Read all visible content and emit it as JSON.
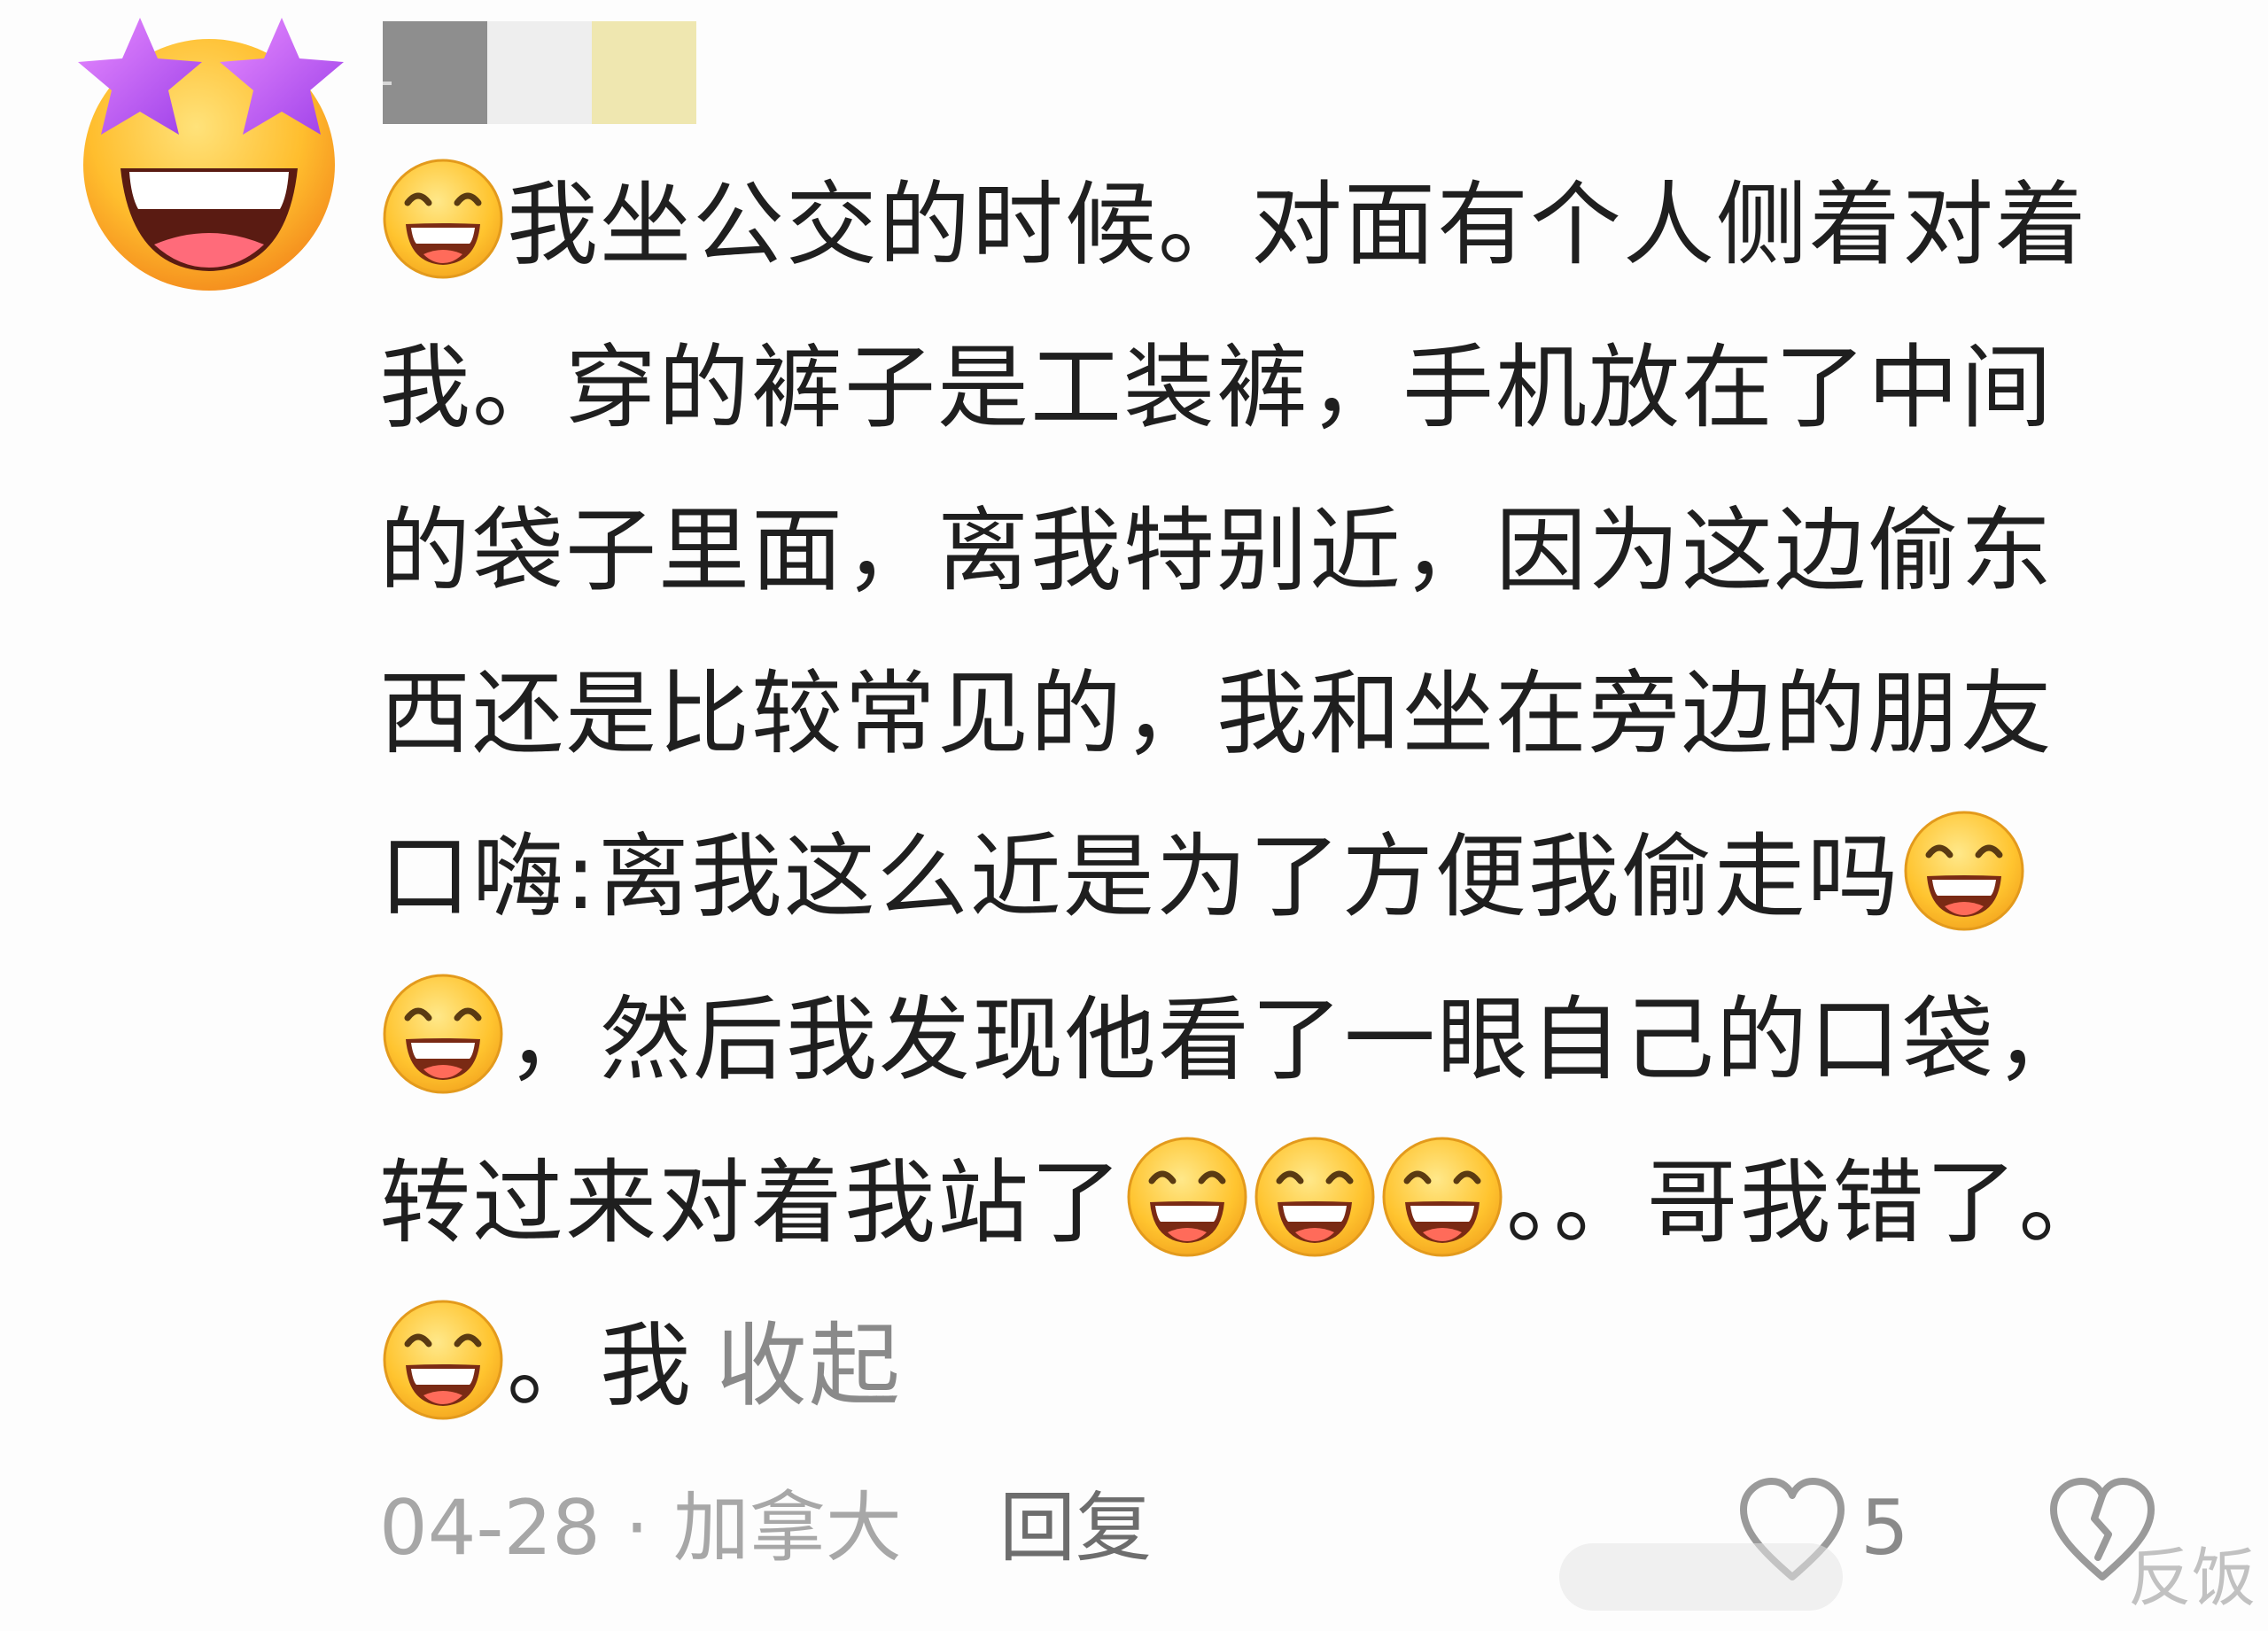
{
  "comment": {
    "lines": [
      [
        "emoji",
        "我坐公交的时候。对面有个人侧着对着"
      ],
      [
        "我。穿的裤子是工装裤，手机放在了中间"
      ],
      [
        "的袋子里面，离我特别近，因为这边偷东"
      ],
      [
        "西还是比较常见的，我和坐在旁边的朋友"
      ],
      [
        "口嗨:离我这么近是为了方便我偷走吗",
        "emoji"
      ],
      [
        "emoji",
        "，然后我发现他看了一眼自己的口袋，"
      ],
      [
        "转过来对着我站了",
        "emoji",
        "emoji",
        "emoji",
        "。。哥我错了。"
      ],
      [
        "emoji",
        "。我"
      ]
    ],
    "line1_text": "我坐公交的时候。对面有个人侧着对着",
    "line2_text": "我。穿的裤子是工装裤，手机放在了中间",
    "line3_text": "的袋子里面，离我特别近，因为这边偷东",
    "line4_text": "西还是比较常见的，我和坐在旁边的朋友",
    "line5_text": "口嗨:离我这么近是为了方便我偷走吗",
    "line6_text": "，然后我发现他看了一眼自己的口袋，",
    "line7_text_a": "转过来对着我站了",
    "line7_text_b": "。。哥我错了。",
    "line8_text": "。我",
    "collapse_label": "收起",
    "emoji_name": "grinning-squint-emoji"
  },
  "footer": {
    "date": "04-28",
    "separator": " · ",
    "location": "加拿大",
    "reply_label": "回复",
    "like_count": "5"
  },
  "watermark": {
    "text": "反饭"
  },
  "colors": {
    "username_block_1": "#8e8e8e",
    "username_block_2": "#eeeeee",
    "username_block_3": "#efe7b0",
    "text": "#1f1f1f",
    "muted": "#a7a7a7"
  },
  "icons": {
    "avatar": "star-eyes-emoji-avatar",
    "like": "heart-like-icon",
    "dislike": "broken-heart-dislike-icon"
  }
}
